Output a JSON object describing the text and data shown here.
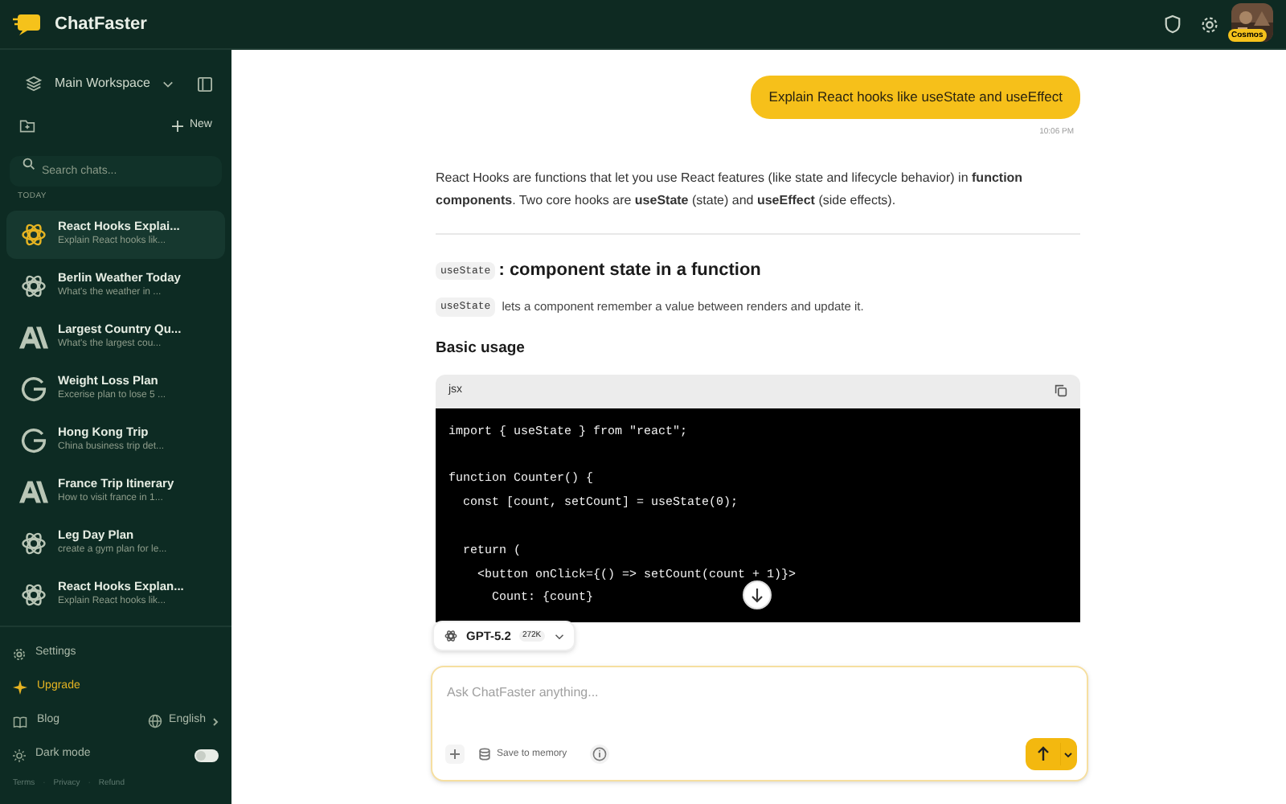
{
  "app": {
    "name": "ChatFaster"
  },
  "topbar": {
    "avatar_label": "Cosmos"
  },
  "sidebar": {
    "workspace": "Main Workspace",
    "new_label": "New",
    "search_placeholder": "Search chats...",
    "section": "TODAY",
    "chats": [
      {
        "title": "React Hooks Explai...",
        "preview": "Explain React hooks lik...",
        "kind": "openai",
        "selected": true
      },
      {
        "title": "Berlin Weather Today",
        "preview": "What's the weather in ...",
        "kind": "openai",
        "selected": false
      },
      {
        "title": "Largest Country Qu...",
        "preview": "What's the largest cou...",
        "kind": "anthropic",
        "selected": false
      },
      {
        "title": "Weight Loss Plan",
        "preview": "Excerise plan to lose 5 ...",
        "kind": "google",
        "selected": false
      },
      {
        "title": "Hong Kong Trip",
        "preview": "China business trip det...",
        "kind": "google",
        "selected": false
      },
      {
        "title": "France Trip Itinerary",
        "preview": "How to visit france in 1...",
        "kind": "anthropic",
        "selected": false
      },
      {
        "title": "Leg Day Plan",
        "preview": "create a gym plan for le...",
        "kind": "openai",
        "selected": false
      },
      {
        "title": "React Hooks Explan...",
        "preview": "Explain React hooks lik...",
        "kind": "openai",
        "selected": false
      }
    ],
    "settings": "Settings",
    "upgrade": "Upgrade",
    "blog": "Blog",
    "language": "English",
    "dark_mode": {
      "label": "Dark mode",
      "on": false
    },
    "footer_links": [
      "Terms",
      "Privacy",
      "Refund"
    ],
    "footer_separator": "·"
  },
  "chat": {
    "user_message": "Explain React hooks like useState and useEffect",
    "time": "10:06 PM",
    "intro": "React Hooks are functions that let you use React features (like state and lifecycle behavior) in **function components**. Two core hooks are **useState** (state) and **useEffect** (side effects).",
    "heading_code": "useState",
    "heading": ": component state in a function",
    "para_code": "useState",
    "para": "lets a component remember a value between renders and update it.",
    "subheading": "Basic usage",
    "code": {
      "language": "jsx",
      "blocks": [
        [
          "import { useState } from \"react\";"
        ],
        [
          "function Counter() {",
          "  const [count, setCount] = useState(0);"
        ],
        [
          "  return (",
          "    <button onClick={() => setCount(count + 1)}>",
          "      Count: {count}"
        ]
      ]
    }
  },
  "composer": {
    "model": "GPT-5.2",
    "context": "272K",
    "placeholder": "Ask ChatFaster anything...",
    "memory": "Save to memory"
  }
}
